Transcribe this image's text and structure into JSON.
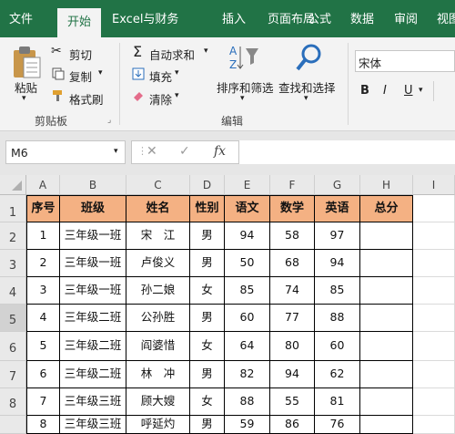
{
  "tabs": [
    "文件",
    "开始",
    "Excel与财务",
    "插入",
    "页面布局",
    "公式",
    "数据",
    "审阅",
    "视图"
  ],
  "ribbon": {
    "clipboard": {
      "paste": "粘贴",
      "cut": "剪切",
      "copy": "复制",
      "format_painter": "格式刷",
      "group": "剪贴板"
    },
    "editing": {
      "autosum": "自动求和",
      "fill": "填充",
      "clear": "清除",
      "sort_filter": "排序和筛选",
      "find_select": "查找和选择",
      "group": "编辑"
    },
    "font": {
      "name": "宋体",
      "bold": "B",
      "italic": "I",
      "underline": "U"
    }
  },
  "formula_bar": {
    "name_box": "M6",
    "fx": "fx",
    "formula": ""
  },
  "sheet": {
    "columns": [
      "A",
      "B",
      "C",
      "D",
      "E",
      "F",
      "G",
      "H",
      "I"
    ],
    "row_numbers": [
      "1",
      "2",
      "3",
      "4",
      "5",
      "6",
      "7",
      "8"
    ],
    "header": [
      "序号",
      "班级",
      "姓名",
      "性别",
      "语文",
      "数学",
      "英语",
      "总分"
    ],
    "rows": [
      [
        "1",
        "三年级一班",
        "宋　江",
        "男",
        "94",
        "58",
        "97",
        ""
      ],
      [
        "2",
        "三年级一班",
        "卢俊义",
        "男",
        "50",
        "68",
        "94",
        ""
      ],
      [
        "3",
        "三年级一班",
        "孙二娘",
        "女",
        "85",
        "74",
        "85",
        ""
      ],
      [
        "4",
        "三年级二班",
        "公孙胜",
        "男",
        "60",
        "77",
        "88",
        ""
      ],
      [
        "5",
        "三年级二班",
        "阎婆惜",
        "女",
        "64",
        "80",
        "60",
        ""
      ],
      [
        "6",
        "三年级二班",
        "林　冲",
        "男",
        "82",
        "94",
        "62",
        ""
      ],
      [
        "7",
        "三年级三班",
        "顾大嫂",
        "女",
        "88",
        "55",
        "81",
        ""
      ],
      [
        "8",
        "三年级三班",
        "呼延灼",
        "男",
        "59",
        "86",
        "76",
        ""
      ]
    ]
  },
  "colors": {
    "accent": "#217346",
    "header_fill": "#f4b183"
  }
}
